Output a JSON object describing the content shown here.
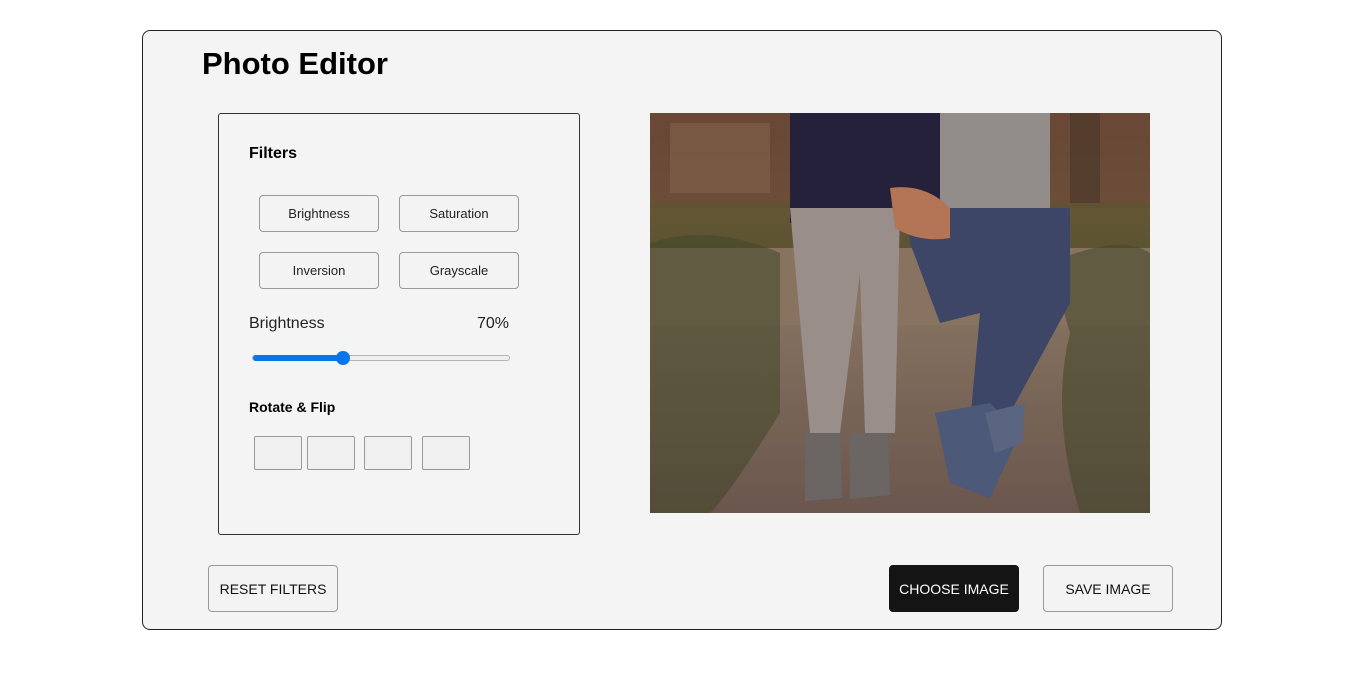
{
  "app": {
    "title": "Photo Editor"
  },
  "filters": {
    "heading": "Filters",
    "buttons": [
      "Brightness",
      "Saturation",
      "Inversion",
      "Grayscale"
    ],
    "active": {
      "label": "Brightness",
      "value_text": "70%",
      "value_fraction": 0.35
    }
  },
  "rotate": {
    "heading": "Rotate & Flip",
    "buttons": [
      "rotate-left-icon",
      "rotate-right-icon",
      "flip-horizontal-icon",
      "flip-vertical-icon"
    ]
  },
  "actions": {
    "reset": "RESET FILTERS",
    "choose": "CHOOSE IMAGE",
    "save": "SAVE IMAGE"
  },
  "colors": {
    "accent": "#0a74ea",
    "dark_button": "#141414",
    "app_background": "#f4f4f4"
  }
}
